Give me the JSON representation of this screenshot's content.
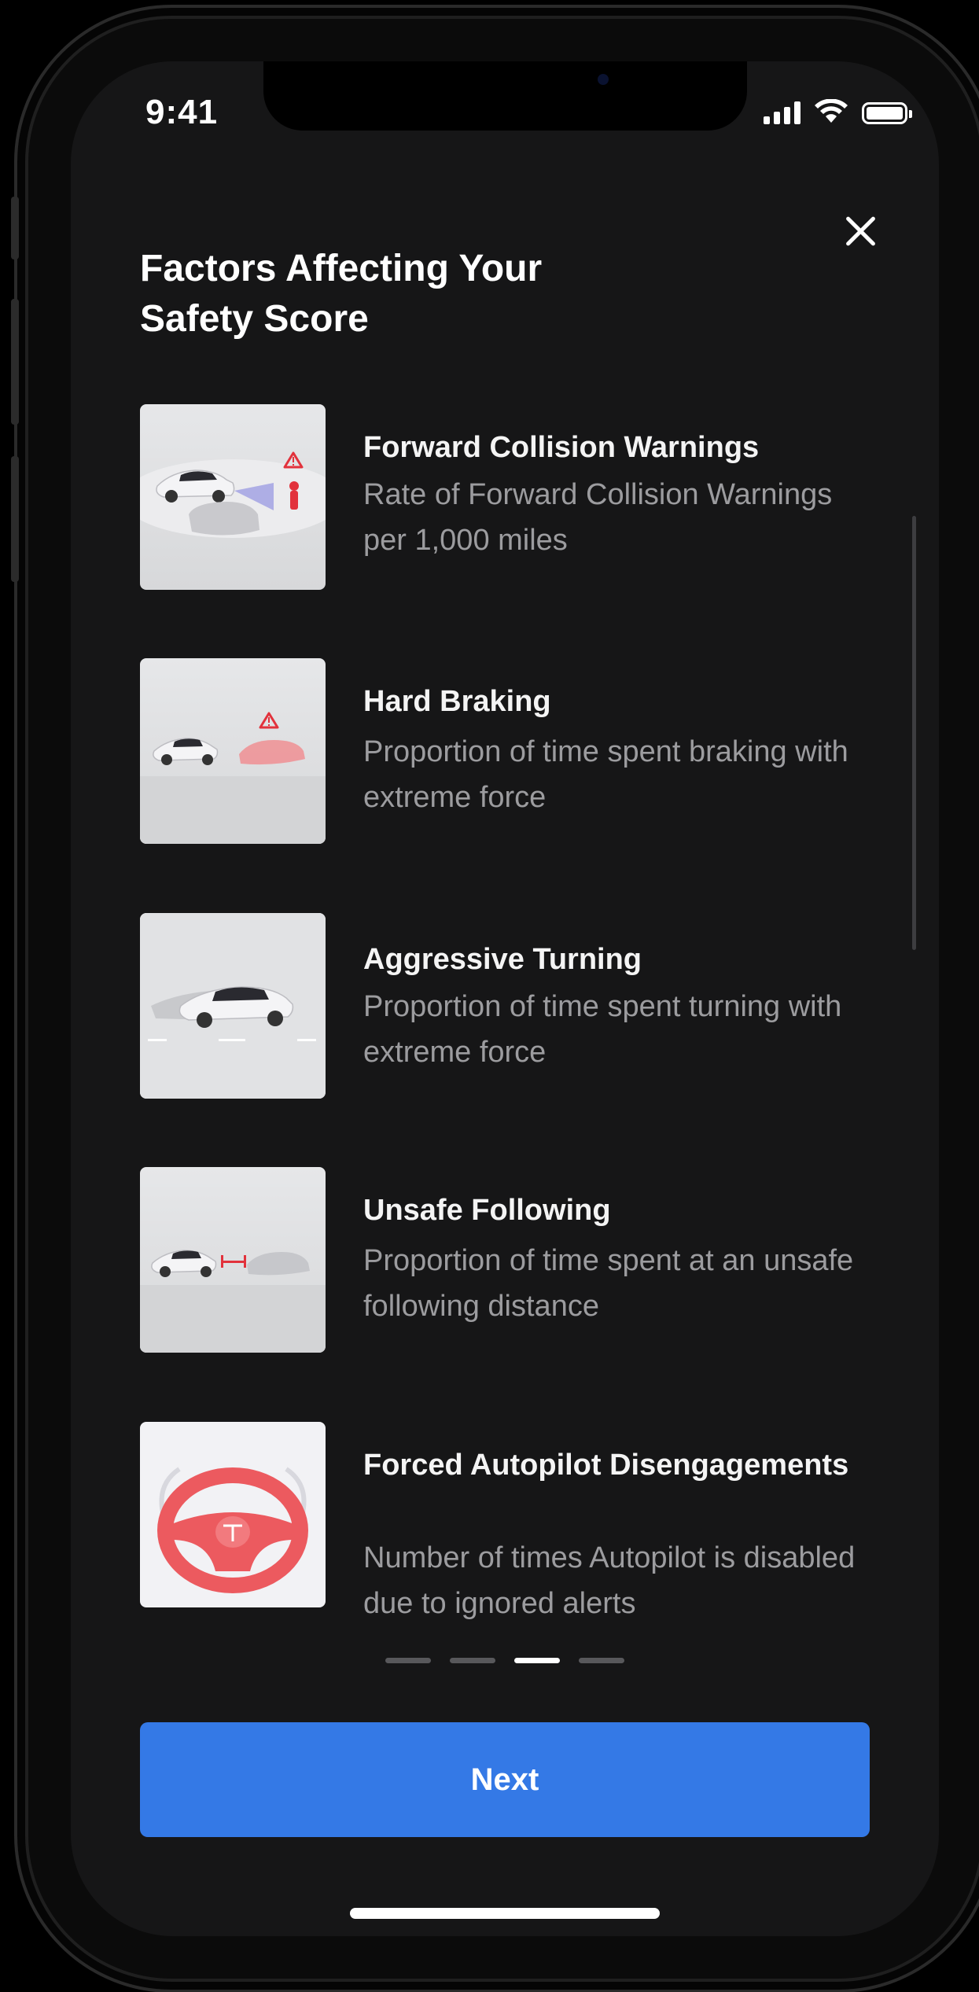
{
  "status_bar": {
    "time": "9:41",
    "icons": [
      "cellular-signal-icon",
      "wifi-icon",
      "battery-icon"
    ]
  },
  "header": {
    "title": "Factors Affecting Your Safety Score",
    "close_icon": "close-icon"
  },
  "factors": [
    {
      "title": "Forward Collision Warnings",
      "description": "Rate of Forward Collision Warnings per 1,000 miles",
      "image": "forward-collision-illustration"
    },
    {
      "title": "Hard Braking",
      "description": "Proportion of time spent braking with extreme force",
      "image": "hard-braking-illustration"
    },
    {
      "title": "Aggressive Turning",
      "description": "Proportion of time spent turning with extreme force",
      "image": "aggressive-turning-illustration"
    },
    {
      "title": "Unsafe Following",
      "description": "Proportion of time spent at an unsafe following distance",
      "image": "unsafe-following-illustration"
    },
    {
      "title": "Forced Autopilot Disengagements",
      "description": "Number of times Autopilot is disabled due to ignored alerts",
      "image": "steering-wheel-illustration"
    }
  ],
  "pagination": {
    "total": 4,
    "active_index": 2
  },
  "footer": {
    "next_label": "Next"
  },
  "colors": {
    "background": "#161617",
    "primary_button": "#3479e6",
    "warning": "#e2323c",
    "title_text": "#f4f4f4",
    "description_text": "#9c9c9f"
  }
}
